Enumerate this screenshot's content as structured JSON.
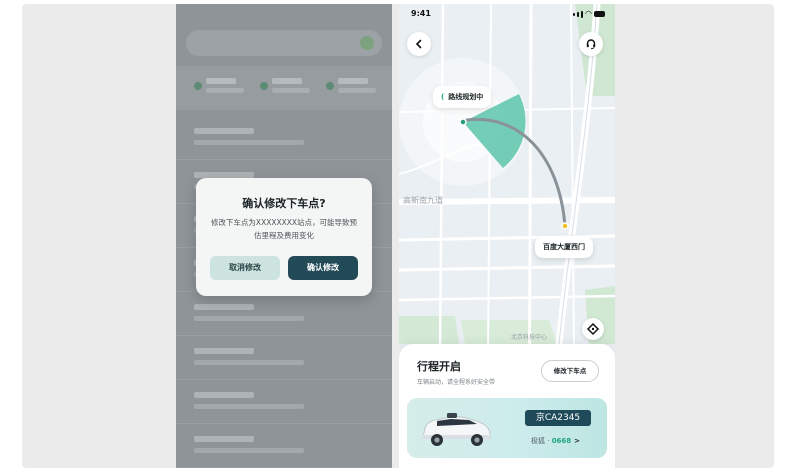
{
  "dialog": {
    "title": "确认修改下车点?",
    "body": "修改下车点为XXXXXXXX站点，可能导致预估里程及费用变化",
    "cancel_label": "取消修改",
    "confirm_label": "确认修改"
  },
  "status_bar": {
    "time": "9:41"
  },
  "map": {
    "route_status": "路线规划中",
    "road_label": "高新南九道",
    "destination": "百度大厦西门",
    "bottom_label": "北京科技中心"
  },
  "trip_panel": {
    "title": "行程开启",
    "subtitle": "车辆启动，请全程系好安全带",
    "modify_button": "修改下车点",
    "plate": "京CA2345",
    "car_info_label": "极狐 · ",
    "car_code": "0668",
    "chevron": ">"
  },
  "icons": {
    "back": "chevron-left-icon",
    "support": "headset-icon",
    "locate": "crosshair-icon",
    "loading": "spinner-icon"
  },
  "colors": {
    "dialog_confirm": "#234a57",
    "dialog_cancel": "#cde3e0",
    "route": "#8a9299",
    "accent_green": "#22a67e",
    "plate_bg": "#1f4a5a"
  }
}
